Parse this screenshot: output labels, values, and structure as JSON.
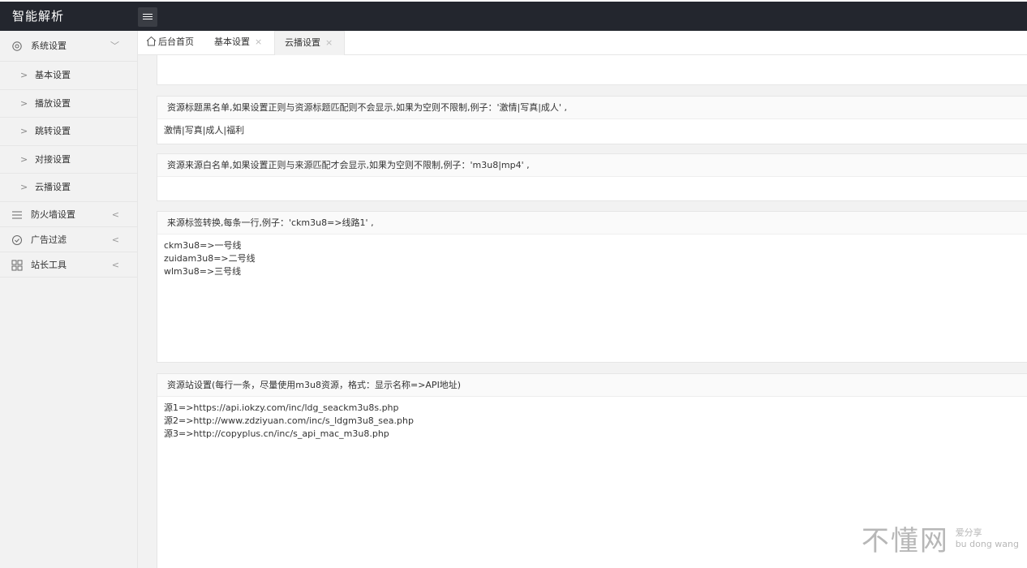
{
  "app": {
    "title": "智能解析"
  },
  "sidebar": {
    "groups": [
      {
        "label": "系统设置",
        "chevron": "﹀",
        "icon": "gear-icon"
      },
      {
        "label": "防火墙设置",
        "chevron": "<",
        "icon": "list-icon"
      },
      {
        "label": "广告过滤",
        "chevron": "<",
        "icon": "check-circle-icon"
      },
      {
        "label": "站长工具",
        "chevron": "<",
        "icon": "grid-icon"
      }
    ],
    "subitems": [
      {
        "label": "基本设置"
      },
      {
        "label": "播放设置"
      },
      {
        "label": "跳转设置"
      },
      {
        "label": "对接设置"
      },
      {
        "label": "云播设置"
      }
    ],
    "sub_arrow": ">"
  },
  "tabs": [
    {
      "label": "后台首页"
    },
    {
      "label": "基本设置",
      "close": "×"
    },
    {
      "label": "云播设置",
      "close": "×"
    }
  ],
  "panels": [
    {
      "header": "",
      "body": ""
    },
    {
      "header": "资源标题黑名单,如果设置正则与资源标题匹配则不会显示,如果为空则不限制,例子：'激情|写真|成人' ,",
      "body": "激情|写真|成人|福利"
    },
    {
      "header": "资源来源白名单,如果设置正则与来源匹配才会显示,如果为空则不限制,例子：'m3u8|mp4' ,",
      "body": ""
    },
    {
      "header": "来源标签转换,每条一行,例子：'ckm3u8=>线路1' ,",
      "body": "ckm3u8=>一号线\nzuidam3u8=>二号线\nwlm3u8=>三号线"
    },
    {
      "header": "资源站设置(每行一条，尽量使用m3u8资源，格式：显示名称=>API地址)",
      "body": "源1=>https://api.iokzy.com/inc/ldg_seackm3u8s.php\n源2=>http://www.zdziyuan.com/inc/s_ldgm3u8_sea.php\n源3=>http://copyplus.cn/inc/s_api_mac_m3u8.php"
    }
  ],
  "watermark": {
    "big": "不懂网",
    "small1": "爱分享",
    "small2": "bu dong wang"
  }
}
